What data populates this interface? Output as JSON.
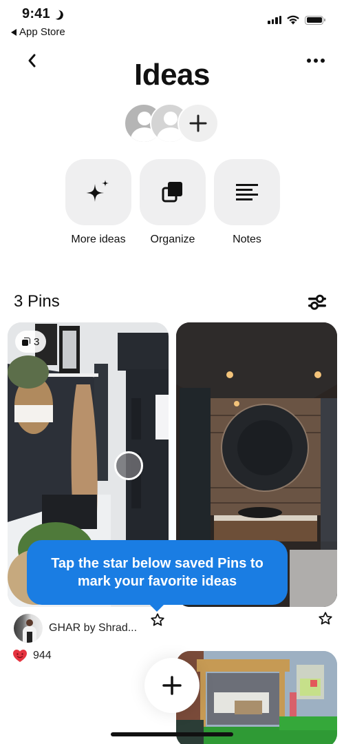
{
  "status_bar": {
    "time": "9:41",
    "back_app_label": "App Store",
    "battery_level": 1.0,
    "signal_bars": 4,
    "icons": [
      "moon-icon",
      "signal-icon",
      "wifi-icon",
      "battery-icon"
    ]
  },
  "header": {
    "title": "Ideas",
    "back_icon": "chevron-left-icon",
    "more_icon": "ellipsis-icon",
    "collaborators": [
      {
        "type": "placeholder-avatar"
      },
      {
        "type": "placeholder-avatar"
      }
    ],
    "add_collaborator_icon": "plus-icon"
  },
  "actions": [
    {
      "label": "More ideas",
      "icon": "sparkle-icon"
    },
    {
      "label": "Organize",
      "icon": "organize-icon"
    },
    {
      "label": "Notes",
      "icon": "notes-icon"
    }
  ],
  "pins_section": {
    "count_label": "3 Pins",
    "filter_icon": "sliders-icon"
  },
  "pins": [
    {
      "badge_count": "3",
      "badge_icon": "stack-icon",
      "description": "hallway with dark wall, basket plant and coat",
      "starred": false
    },
    {
      "description": "rustic bathroom with round mirror",
      "starred": false
    },
    {
      "description": "garden pergola with lounge seating"
    }
  ],
  "tooltip": {
    "text": "Tap the star below saved Pins to mark your favorite ideas",
    "color": "#1a7de3"
  },
  "creator": {
    "name": "GHAR by Shrad..."
  },
  "reactions": {
    "icon": "heart-face-icon",
    "count": "944",
    "color": "#e5333f"
  },
  "fab": {
    "icon": "plus-icon"
  }
}
